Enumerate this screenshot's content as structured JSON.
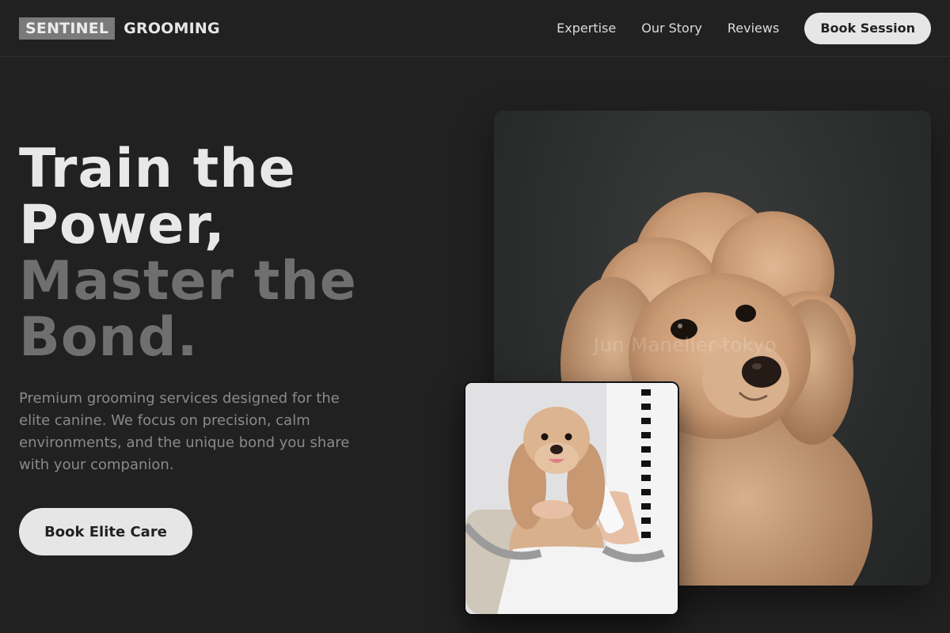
{
  "brand": {
    "box": "SENTINEL",
    "word": "GROOMING"
  },
  "nav": {
    "links": [
      "Expertise",
      "Our Story",
      "Reviews"
    ],
    "cta": "Book Session"
  },
  "hero": {
    "headline_light": [
      "Train the",
      "Power,"
    ],
    "headline_dim": [
      "Master the",
      "Bond."
    ],
    "description": "Premium grooming services designed for the elite canine. We focus on precision, calm environments, and the unique bond you share with your companion.",
    "cta": "Book Elite Care"
  },
  "images": {
    "main": {
      "subject": "apricot toy poodle portrait",
      "watermark": "Jun Maneller tokyo"
    },
    "inset": {
      "subject": "cocker spaniel being groomed with clipper"
    }
  },
  "colors": {
    "background": "#212121",
    "accent_button": "#e6e6e6",
    "headline_light": "#e8e8e8",
    "headline_dim": "#6f6f6f"
  }
}
